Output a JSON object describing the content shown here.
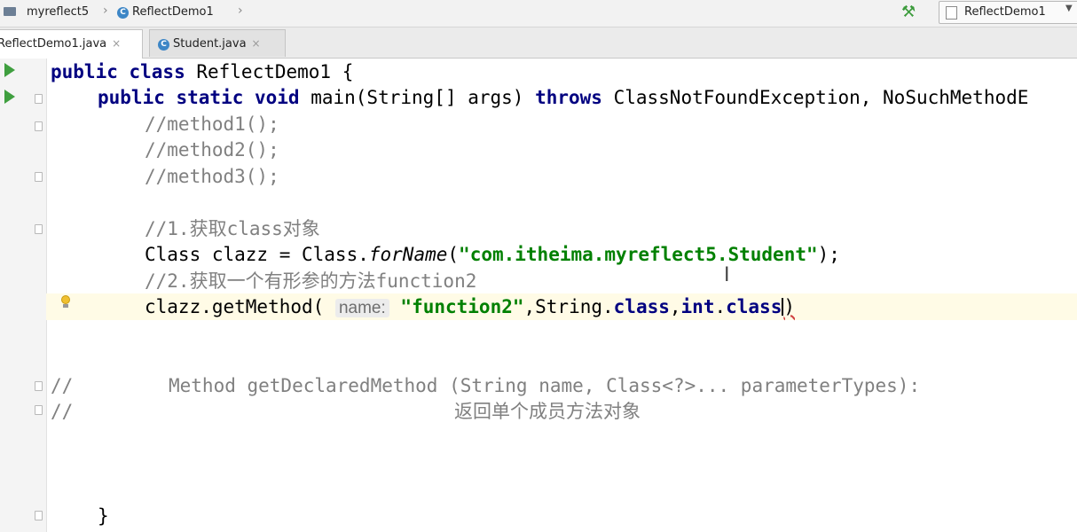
{
  "navbar": {
    "project": "myreflect5",
    "file": "ReflectDemo1",
    "run_config": "ReflectDemo1"
  },
  "tabs": [
    {
      "label": "ReflectDemo1.java",
      "close": "×"
    },
    {
      "label": "Student.java",
      "close": "×"
    }
  ],
  "code": {
    "l1_kw": "public class",
    "l1_rest": " ReflectDemo1 {",
    "l2_kw": "public static void",
    "l2_mid": " main(String[] args) ",
    "l2_throws": "throws",
    "l2_rest": " ClassNotFoundException, NoSuchMethodE",
    "l3": "//method1();",
    "l4": "//method2();",
    "l5": "//method3();",
    "l6": "//1.获取class对象",
    "l7_a": "Class clazz = Class.",
    "l7_method": "forName",
    "l7_b": "(",
    "l7_str": "\"com.itheima.myreflect5.Student\"",
    "l7_c": ");",
    "l8": "//2.获取一个有形参的方法function2",
    "l9_a": "clazz.getMethod(",
    "l9_hint": "name:",
    "l9_str": "\"function2\"",
    "l9_b": ",String.",
    "l9_kw1": "class",
    "l9_c": ",",
    "l9_kw2": "int",
    "l9_d": ".",
    "l9_kw3": "class",
    "l9_e": ")",
    "l10_slash": "//",
    "l10_text": "Method getDeclaredMethod (String name, Class<?>... parameterTypes):",
    "l11_slash": "//",
    "l11_text": "返回单个成员方法对象",
    "l12": "}"
  }
}
